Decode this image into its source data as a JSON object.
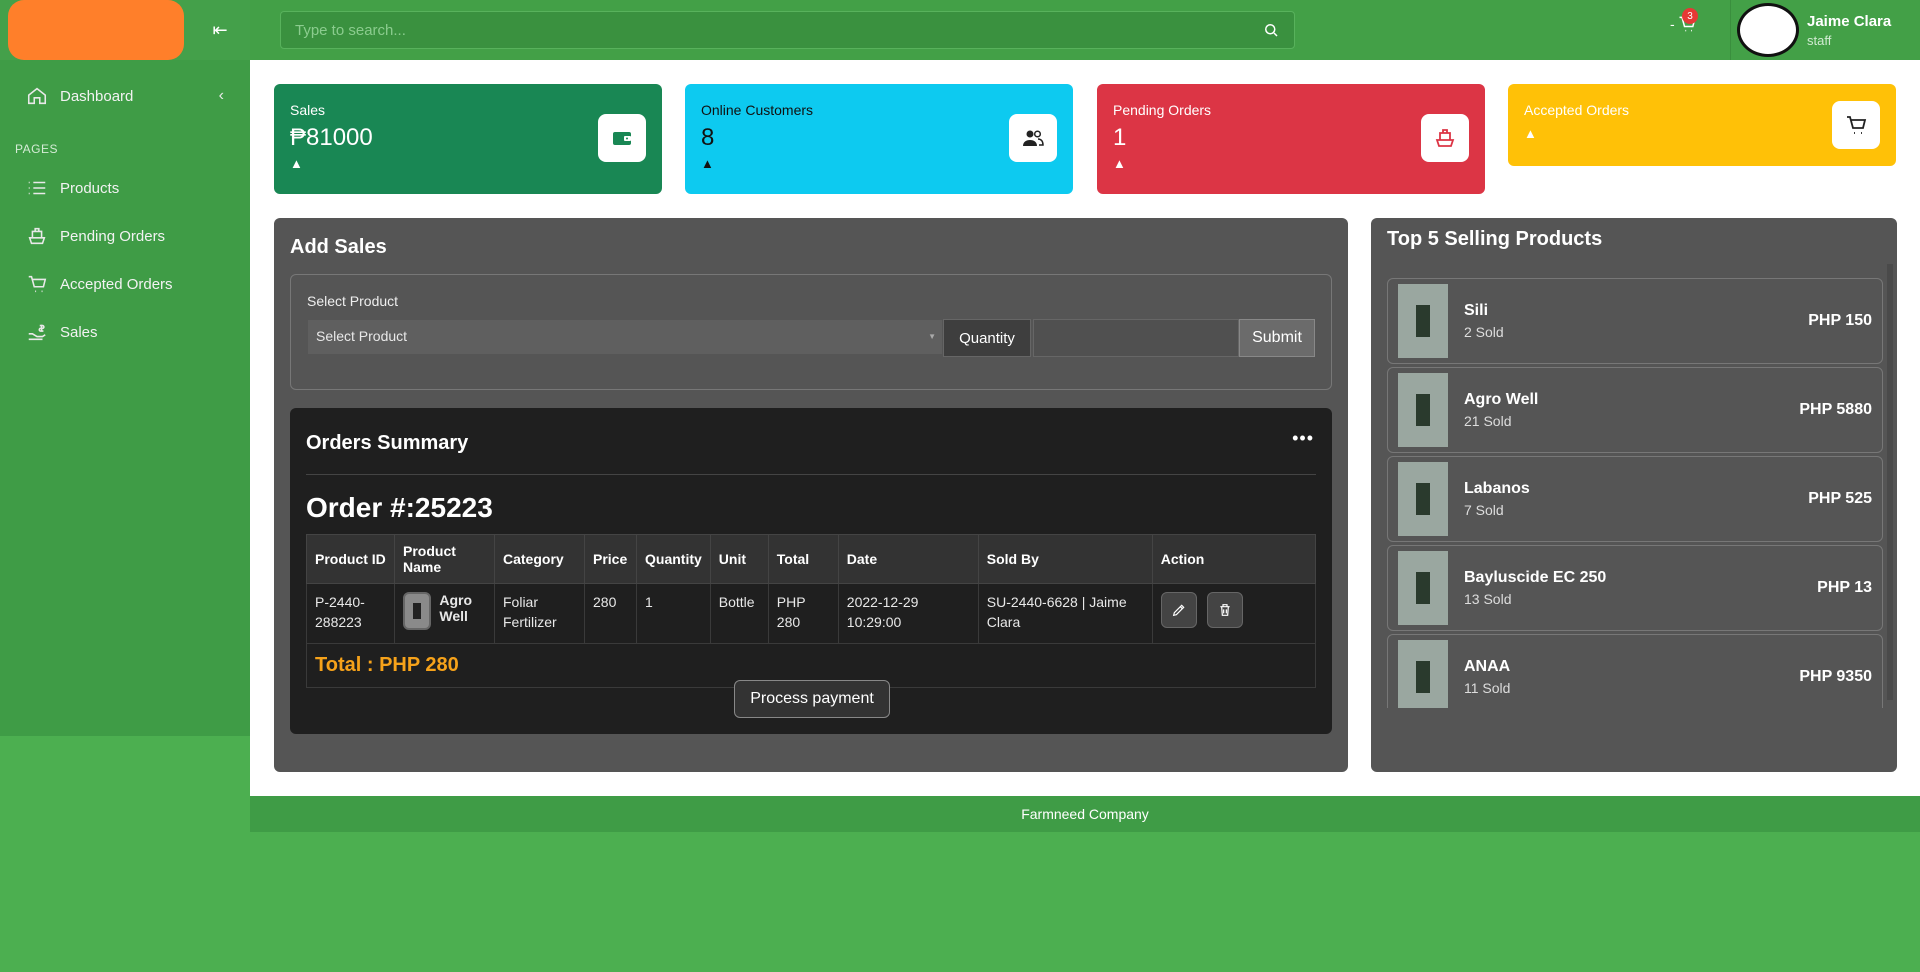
{
  "search": {
    "placeholder": "Type to search..."
  },
  "cart": {
    "dash": "-",
    "count": "3"
  },
  "user": {
    "name": "Jaime Clara",
    "role": "staff"
  },
  "sidebar": {
    "dashboard_label": "Dashboard",
    "section_label": "PAGES",
    "items": [
      {
        "label": "Products"
      },
      {
        "label": "Pending Orders"
      },
      {
        "label": "Accepted Orders"
      },
      {
        "label": "Sales"
      }
    ]
  },
  "cards": {
    "sales": {
      "label": "Sales",
      "value": "₱81000",
      "trend": "▲"
    },
    "customers": {
      "label": "Online Customers",
      "value": "8",
      "trend": "▲"
    },
    "pending": {
      "label": "Pending Orders",
      "value": "1",
      "trend": "▲"
    },
    "accepted": {
      "label": "Accepted Orders",
      "trend": "▲"
    }
  },
  "add_sales": {
    "title": "Add Sales",
    "select_label": "Select Product",
    "select_value": "Select Product",
    "quantity_label": "Quantity",
    "submit_label": "Submit"
  },
  "orders": {
    "title": "Orders Summary",
    "menu": "•••",
    "order_number": "Order #:25223",
    "headers": [
      "Product ID",
      "Product Name",
      "Category",
      "Price",
      "Quantity",
      "Unit",
      "Total",
      "Date",
      "Sold By",
      "Action"
    ],
    "rows": [
      {
        "product_id": "P-2440-288223",
        "product_name": "Agro Well",
        "category": "Foliar Fertilizer",
        "price": "280",
        "quantity": "1",
        "unit": "Bottle",
        "total": "PHP 280",
        "date": "2022-12-29 10:29:00",
        "sold_by": "SU-2440-6628 | Jaime Clara"
      }
    ],
    "total_text": "Total : PHP 280",
    "pay_label": "Process payment"
  },
  "top_selling": {
    "title": "Top 5 Selling Products",
    "items": [
      {
        "name": "Sili",
        "sold": "2 Sold",
        "price": "PHP 150"
      },
      {
        "name": "Agro Well",
        "sold": "21 Sold",
        "price": "PHP 5880"
      },
      {
        "name": "Labanos",
        "sold": "7 Sold",
        "price": "PHP 525"
      },
      {
        "name": "Bayluscide EC 250",
        "sold": "13 Sold",
        "price": "PHP 13"
      },
      {
        "name": "ANAA",
        "sold": "11 Sold",
        "price": "PHP 9350"
      }
    ]
  },
  "footer": {
    "text": "Farmneed Company"
  },
  "colors": {
    "sidebar": "#3f9c46",
    "sales_card": "#198754",
    "customers_card": "#0dcaf0",
    "pending_card": "#dc3545",
    "accepted_card": "#ffc107",
    "total_text": "#f6a21a"
  }
}
